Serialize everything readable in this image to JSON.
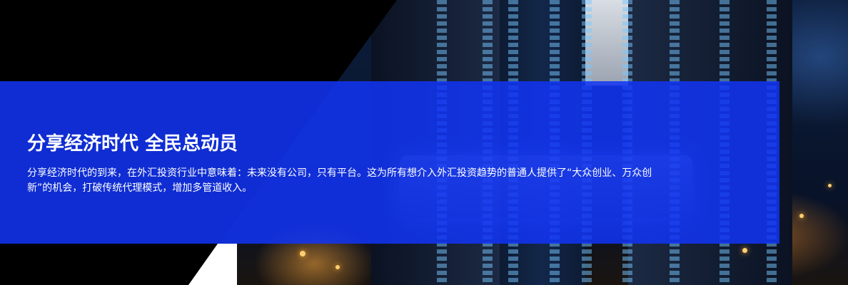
{
  "banner": {
    "title": "分享经济时代 全民总动员",
    "description": "分享经济时代的到来，在外汇投资行业中意味着：未来没有公司，只有平台。这为所有想介入外汇投资趋势的普通人提供了“大众创业、万众创新”的机会，打破传统代理模式，增加多管道收入。",
    "overlay_color": "#1234f5",
    "image": "businessman-holding-tablet-over-night-city"
  }
}
